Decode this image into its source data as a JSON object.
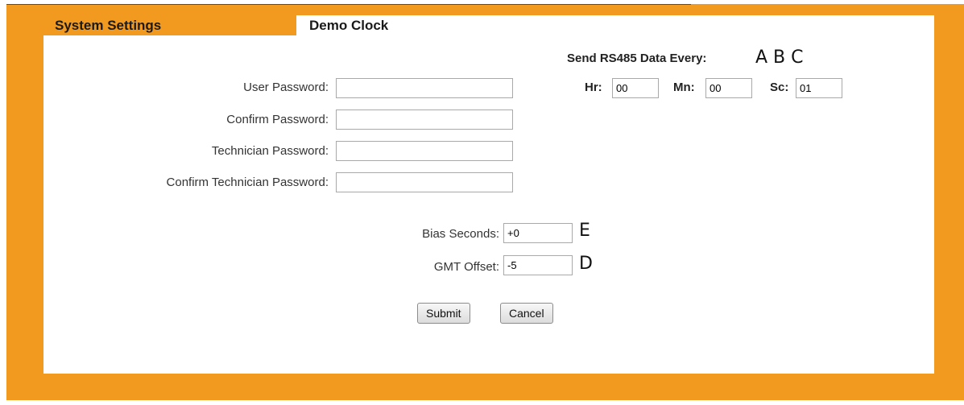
{
  "tabs": {
    "system_settings": "System Settings",
    "demo_clock": "Demo Clock"
  },
  "rs485": {
    "heading": "Send RS485 Data Every:",
    "markers": "A B C",
    "hr_label": "Hr:",
    "hr_value": "00",
    "mn_label": "Mn:",
    "mn_value": "00",
    "sc_label": "Sc:",
    "sc_value": "01"
  },
  "passwords": {
    "user_label": "User Password:",
    "user_value": "",
    "confirm_label": "Confirm Password:",
    "confirm_value": "",
    "tech_label": "Technician Password:",
    "tech_value": "",
    "confirm_tech_label": "Confirm Technician Password:",
    "confirm_tech_value": ""
  },
  "clock": {
    "bias_label": "Bias Seconds:",
    "bias_value": "+0",
    "bias_marker": "E",
    "gmt_label": "GMT Offset:",
    "gmt_value": "-5",
    "gmt_marker": "D"
  },
  "buttons": {
    "submit": "Submit",
    "cancel": "Cancel"
  },
  "colors": {
    "frame": "#f29a1f",
    "panel": "#ffffff"
  }
}
